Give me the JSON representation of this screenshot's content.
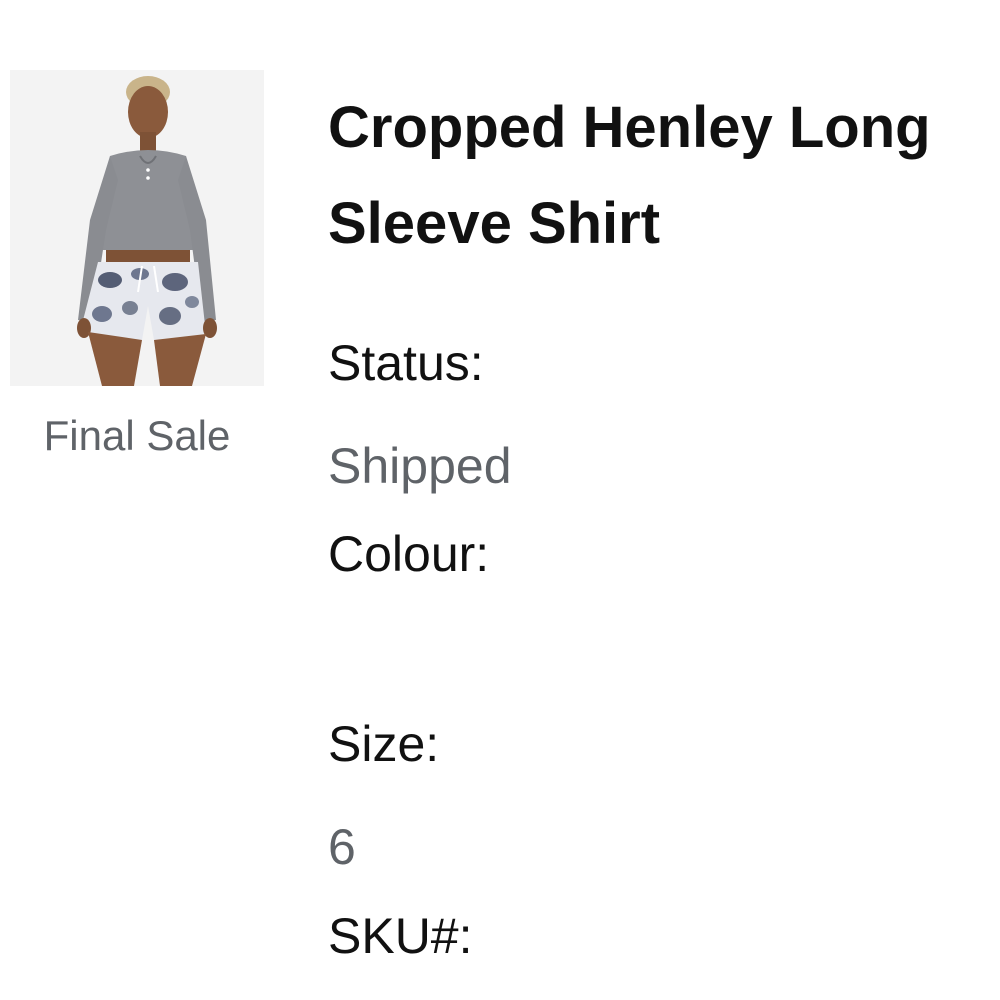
{
  "product": {
    "title": "Cropped Henley Long Sleeve Shirt",
    "badge": "Final Sale"
  },
  "fields": {
    "status_label": "Status:",
    "status_value": "Shipped",
    "colour_label": "Colour:",
    "colour_value": "",
    "size_label": "Size:",
    "size_value": "6",
    "sku_label": "SKU#:"
  },
  "colors": {
    "secondary_text": "#5f6368",
    "primary_text": "#111111"
  }
}
